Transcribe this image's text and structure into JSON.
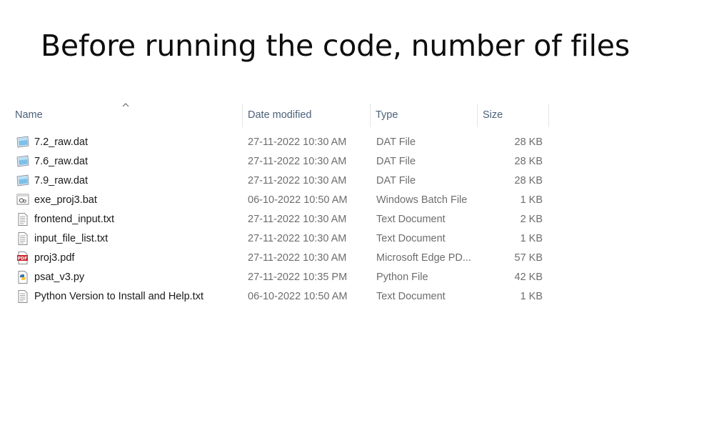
{
  "title": "Before running the code, number of files",
  "explorer": {
    "columns": {
      "name": "Name",
      "date_modified": "Date modified",
      "type": "Type",
      "size": "Size"
    },
    "sort_indicator": "^",
    "files": [
      {
        "name": "7.2_raw.dat",
        "date": "27-11-2022 10:30 AM",
        "type": "DAT File",
        "size": "28 KB",
        "icon": "dat-file-icon"
      },
      {
        "name": "7.6_raw.dat",
        "date": "27-11-2022 10:30 AM",
        "type": "DAT File",
        "size": "28 KB",
        "icon": "dat-file-icon"
      },
      {
        "name": "7.9_raw.dat",
        "date": "27-11-2022 10:30 AM",
        "type": "DAT File",
        "size": "28 KB",
        "icon": "dat-file-icon"
      },
      {
        "name": "exe_proj3.bat",
        "date": "06-10-2022 10:50 AM",
        "type": "Windows Batch File",
        "size": "1 KB",
        "icon": "batch-file-icon"
      },
      {
        "name": "frontend_input.txt",
        "date": "27-11-2022 10:30 AM",
        "type": "Text Document",
        "size": "2 KB",
        "icon": "text-file-icon"
      },
      {
        "name": "input_file_list.txt",
        "date": "27-11-2022 10:30 AM",
        "type": "Text Document",
        "size": "1 KB",
        "icon": "text-file-icon"
      },
      {
        "name": "proj3.pdf",
        "date": "27-11-2022 10:30 AM",
        "type": "Microsoft Edge PD...",
        "size": "57 KB",
        "icon": "pdf-file-icon"
      },
      {
        "name": "psat_v3.py",
        "date": "27-11-2022 10:35 PM",
        "type": "Python File",
        "size": "42 KB",
        "icon": "python-file-icon"
      },
      {
        "name": "Python Version to Install and Help.txt",
        "date": "06-10-2022 10:50 AM",
        "type": "Text Document",
        "size": "1 KB",
        "icon": "text-file-icon"
      }
    ]
  },
  "colors": {
    "header_text": "#4c607a",
    "secondary_text": "#6d6d6d",
    "primary_text": "#1a1a1a",
    "pdf_red": "#c4262e",
    "python_blue": "#3776ab",
    "python_yellow": "#f7c93e"
  }
}
